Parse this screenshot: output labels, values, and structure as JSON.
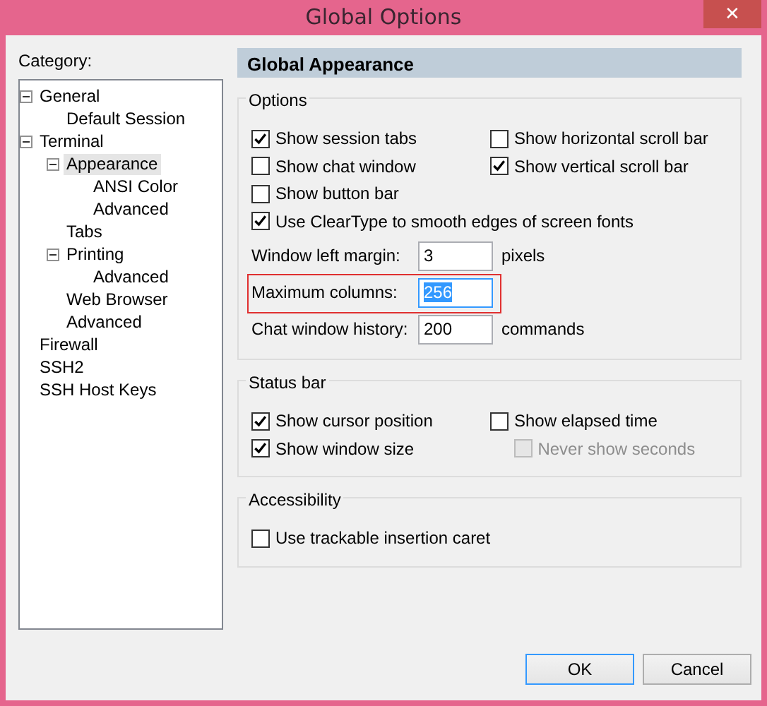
{
  "window": {
    "title": "Global Options",
    "close": "✕"
  },
  "category_label": "Category:",
  "tree": [
    {
      "label": "General",
      "expanded": true,
      "selected": false,
      "children": [
        {
          "label": "Default Session",
          "selected": false
        }
      ]
    },
    {
      "label": "Terminal",
      "expanded": true,
      "selected": false,
      "children": [
        {
          "label": "Appearance",
          "expanded": true,
          "selected": true,
          "children": [
            {
              "label": "ANSI Color",
              "selected": false
            },
            {
              "label": "Advanced",
              "selected": false
            }
          ]
        },
        {
          "label": "Tabs",
          "selected": false
        },
        {
          "label": "Printing",
          "expanded": true,
          "selected": false,
          "children": [
            {
              "label": "Advanced",
              "selected": false
            }
          ]
        },
        {
          "label": "Web Browser",
          "selected": false
        },
        {
          "label": "Advanced",
          "selected": false
        }
      ]
    },
    {
      "label": "Firewall",
      "selected": false
    },
    {
      "label": "SSH2",
      "selected": false
    },
    {
      "label": "SSH Host Keys",
      "selected": false
    }
  ],
  "panel_title": "Global Appearance",
  "groups": [
    {
      "title": "Options",
      "rows": [
        [
          {
            "kind": "checkbox",
            "label": "Show session tabs",
            "checked": true,
            "disabled": false
          },
          {
            "kind": "checkbox",
            "label": "Show horizontal scroll bar",
            "checked": false,
            "disabled": false
          }
        ],
        [
          {
            "kind": "checkbox",
            "label": "Show chat window",
            "checked": false,
            "disabled": false
          },
          {
            "kind": "checkbox",
            "label": "Show vertical scroll bar",
            "checked": true,
            "disabled": false
          }
        ],
        [
          {
            "kind": "checkbox",
            "label": "Show button bar",
            "checked": false,
            "disabled": false
          }
        ],
        [
          {
            "kind": "checkbox",
            "label": "Use ClearType to smooth edges of screen fonts",
            "checked": true,
            "disabled": false
          }
        ],
        [
          {
            "kind": "field",
            "label": "Window left margin:",
            "value": "3",
            "unit": "pixels",
            "focused": false,
            "highlighted": false
          }
        ],
        [
          {
            "kind": "field",
            "label": "Maximum columns:",
            "value": "256",
            "focused": true,
            "highlighted": true
          }
        ],
        [
          {
            "kind": "field",
            "label": "Chat window history:",
            "value": "200",
            "unit": "commands",
            "focused": false,
            "highlighted": false
          }
        ]
      ]
    },
    {
      "title": "Status bar",
      "rows": [
        [
          {
            "kind": "checkbox",
            "label": "Show cursor position",
            "checked": true,
            "disabled": false
          },
          {
            "kind": "checkbox",
            "label": "Show elapsed time",
            "checked": false,
            "disabled": false
          }
        ],
        [
          {
            "kind": "checkbox",
            "label": "Show window size",
            "checked": true,
            "disabled": false
          },
          {
            "kind": "checkbox",
            "label": "Never show seconds",
            "checked": false,
            "disabled": true
          }
        ]
      ]
    },
    {
      "title": "Accessibility",
      "rows": [
        [
          {
            "kind": "checkbox",
            "label": "Use trackable insertion caret",
            "checked": false,
            "disabled": false
          }
        ]
      ]
    }
  ],
  "buttons": [
    {
      "label": "OK",
      "default": true
    },
    {
      "label": "Cancel",
      "default": false
    }
  ]
}
